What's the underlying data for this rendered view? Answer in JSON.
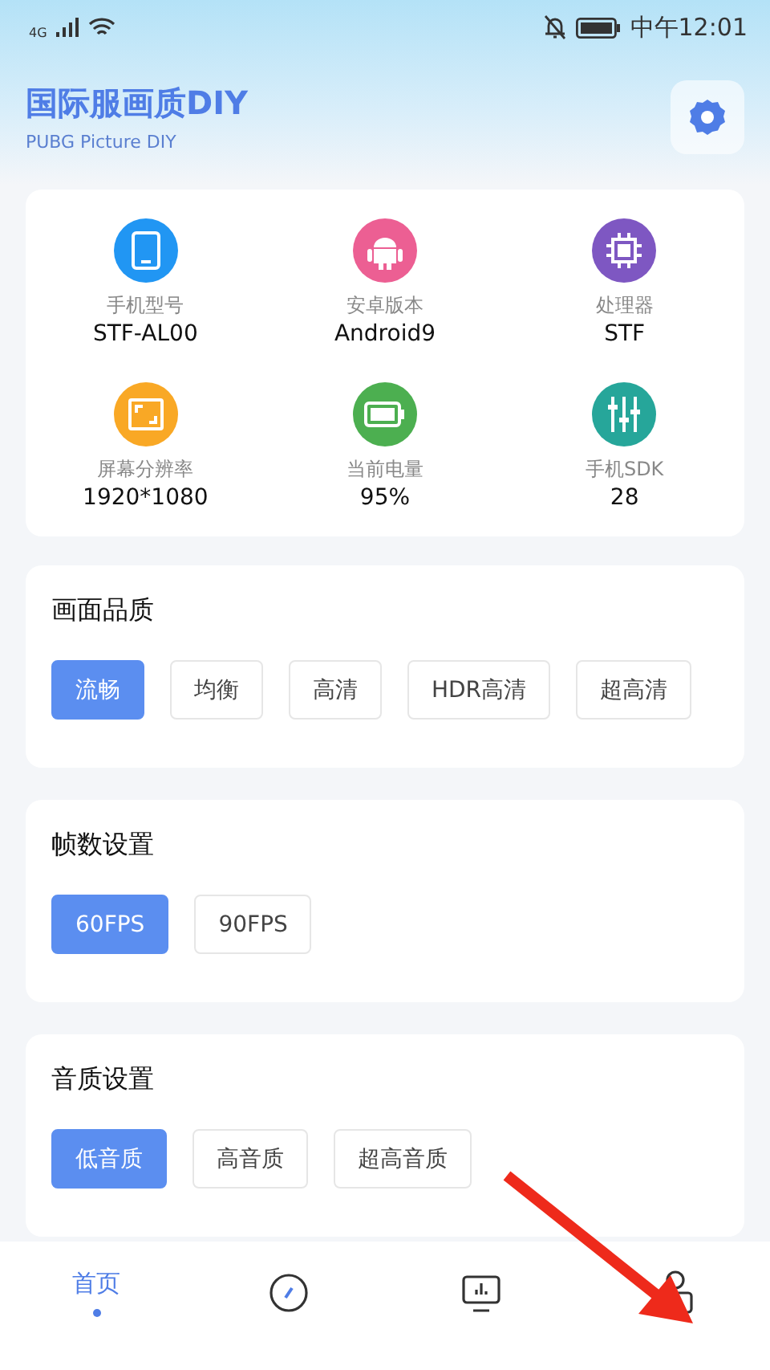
{
  "status_bar": {
    "network": "4G",
    "time": "中午12:01"
  },
  "header": {
    "title": "国际服画质DIY",
    "subtitle": "PUBG Picture DIY"
  },
  "device_info": [
    {
      "kind": "tablet",
      "color": "#2196f3",
      "label": "手机型号",
      "value": "STF-AL00"
    },
    {
      "kind": "android",
      "color": "#ec5f93",
      "label": "安卓版本",
      "value": "Android9"
    },
    {
      "kind": "chip",
      "color": "#7e57c2",
      "label": "处理器",
      "value": "STF"
    },
    {
      "kind": "screen",
      "color": "#f9a825",
      "label": "屏幕分辨率",
      "value": "1920*1080"
    },
    {
      "kind": "battery",
      "color": "#4caf50",
      "label": "当前电量",
      "value": "95%"
    },
    {
      "kind": "sliders",
      "color": "#26a69a",
      "label": "手机SDK",
      "value": "28"
    }
  ],
  "sections": [
    {
      "title": "画面品质",
      "options": [
        {
          "label": "流畅",
          "selected": true
        },
        {
          "label": "均衡",
          "selected": false
        },
        {
          "label": "高清",
          "selected": false
        },
        {
          "label": "HDR高清",
          "selected": false
        },
        {
          "label": "超高清",
          "selected": false
        }
      ]
    },
    {
      "title": "帧数设置",
      "options": [
        {
          "label": "60FPS",
          "selected": true
        },
        {
          "label": "90FPS",
          "selected": false
        }
      ]
    },
    {
      "title": "音质设置",
      "options": [
        {
          "label": "低音质",
          "selected": true
        },
        {
          "label": "高音质",
          "selected": false
        },
        {
          "label": "超高音质",
          "selected": false
        }
      ]
    }
  ],
  "bottom_nav": [
    {
      "kind": "text",
      "label": "首页",
      "selected": true
    },
    {
      "kind": "compass",
      "selected": false
    },
    {
      "kind": "monitor",
      "selected": false
    },
    {
      "kind": "profile",
      "selected": false
    }
  ]
}
